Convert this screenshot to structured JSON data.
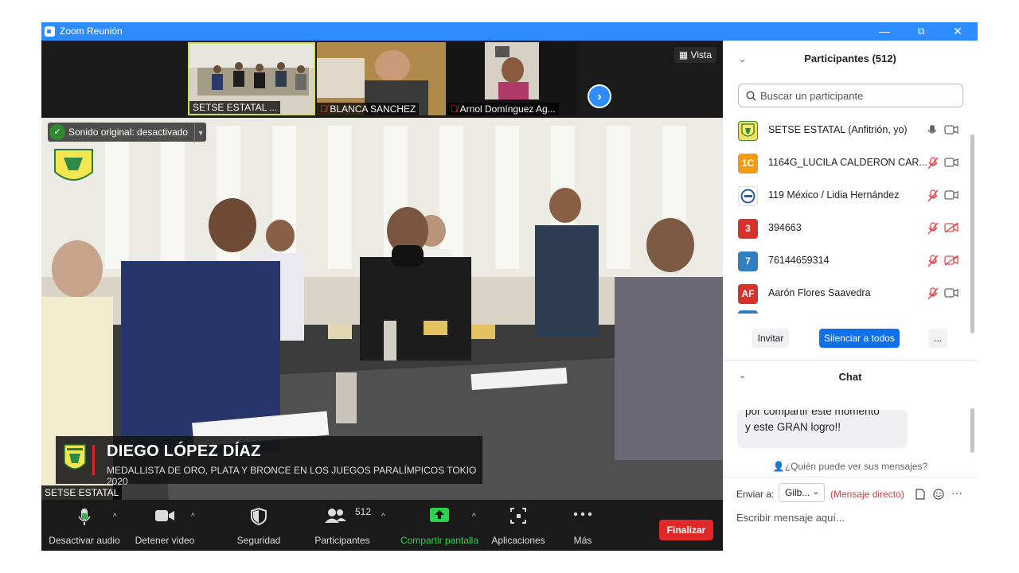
{
  "window": {
    "title": "Zoom Reunión",
    "minimize_label": "—",
    "restore_label": "⧉",
    "close_label": "✕"
  },
  "thumbnails": [
    {
      "name": "SETSE ESTATAL ..."
    },
    {
      "name": "BLANCA SANCHEZ"
    },
    {
      "name": "Arnol Domínguez Ag..."
    }
  ],
  "vista_label": "Vista",
  "main_video": {
    "sonido_label": "Sonido original: desactivado",
    "lower_third_name": "DIEGO LÓPEZ DÍAZ",
    "lower_third_subtitle": "MEDALLISTA DE ORO, PLATA Y BRONCE EN LOS JUEGOS PARALÍMPICOS TOKIO 2020",
    "speaker_tag": "SETSE ESTATAL"
  },
  "toolbar": {
    "audio_label": "Desactivar audio",
    "video_label": "Detener video",
    "security_label": "Seguridad",
    "participants_label": "Participantes",
    "participants_count": "512",
    "share_label": "Compartir pantalla",
    "apps_label": "Aplicaciones",
    "more_label": "Más",
    "end_label": "Finalizar"
  },
  "participants_panel": {
    "title": "Participantes (512)",
    "search_placeholder": "Buscar un participante",
    "items": [
      {
        "initials": "",
        "name": "SETSE ESTATAL (Anfitrión, yo)",
        "color": "#f2e05a",
        "muted": false,
        "video_off": false
      },
      {
        "initials": "1C",
        "name": "1164G_LUCILA CALDERON CAR...",
        "color": "#f39c12",
        "muted": true,
        "video_off": false
      },
      {
        "initials": "",
        "name": "119 México / Lidia Hernández",
        "color": "#ffffff",
        "muted": true,
        "video_off": false
      },
      {
        "initials": "3",
        "name": "394663",
        "color": "#d9312b",
        "muted": true,
        "video_off": true
      },
      {
        "initials": "7",
        "name": "76144659314",
        "color": "#2f7fc1",
        "muted": true,
        "video_off": true
      },
      {
        "initials": "AF",
        "name": "Aarón Flores Saavedra",
        "color": "#d9312b",
        "muted": true,
        "video_off": false
      }
    ],
    "invite_label": "Invitar",
    "mute_all_label": "Silenciar a todos",
    "more_label": "..."
  },
  "chat": {
    "title": "Chat",
    "message_line1": "por compartir este momento",
    "message_line2": "y este GRAN logro!!",
    "who_can_see": "¿Quién puede ver sus mensajes?",
    "send_to_label": "Enviar a:",
    "recipient": "Gilb...",
    "direct_label": "(Mensaje directo)",
    "input_placeholder": "Escribir mensaje aquí..."
  }
}
